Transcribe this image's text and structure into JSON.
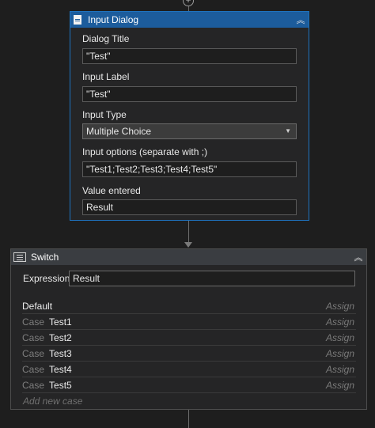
{
  "connector": {
    "add_symbol": "+"
  },
  "input_dialog": {
    "title": "Input Dialog",
    "collapse_glyph": "︽",
    "fields": {
      "dialog_title_label": "Dialog Title",
      "dialog_title_value": "\"Test\"",
      "input_label_label": "Input Label",
      "input_label_value": "\"Test\"",
      "input_type_label": "Input Type",
      "input_type_value": "Multiple Choice",
      "input_options_label": "Input options (separate with ;)",
      "input_options_value": "\"Test1;Test2;Test3;Test4;Test5\"",
      "value_entered_label": "Value entered",
      "value_entered_value": "Result"
    },
    "icon": "document-icon"
  },
  "switch_activity": {
    "title": "Switch",
    "collapse_glyph": "︽",
    "icon": "switch-icon",
    "expression_label": "Expression",
    "expression_value": "Result",
    "default_label": "Default",
    "case_keyword": "Case",
    "assign_label": "Assign",
    "cases": [
      "Test1",
      "Test2",
      "Test3",
      "Test4",
      "Test5"
    ],
    "add_case_label": "Add new case"
  },
  "colors": {
    "canvas": "#1e1e1e",
    "selected_border": "#1e73c0",
    "selected_header": "#1c5c9c"
  }
}
